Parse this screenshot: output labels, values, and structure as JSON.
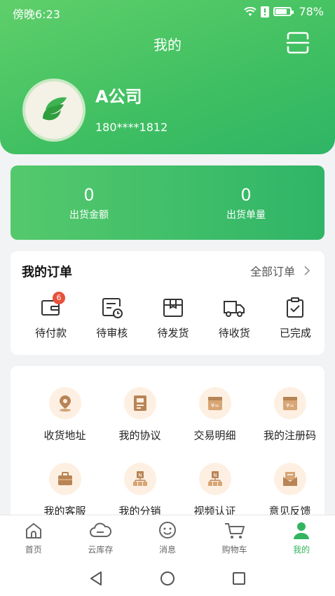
{
  "status_bar": {
    "time": "傍晚6:23",
    "battery": "78%"
  },
  "header": {
    "title": "我的"
  },
  "profile": {
    "company": "A公司",
    "phone": "180****1812"
  },
  "stats": [
    {
      "value": "0",
      "label": "出货金额"
    },
    {
      "value": "0",
      "label": "出货单量"
    }
  ],
  "orders": {
    "title": "我的订单",
    "all_label": "全部订单",
    "items": [
      {
        "label": "待付款",
        "badge": "6",
        "icon": "wallet-icon"
      },
      {
        "label": "待审核",
        "icon": "review-clock-icon"
      },
      {
        "label": "待发货",
        "icon": "package-icon"
      },
      {
        "label": "待收货",
        "icon": "truck-icon"
      },
      {
        "label": "已完成",
        "icon": "clipboard-check-icon"
      }
    ]
  },
  "services": [
    {
      "label": "收货地址",
      "icon": "location-pin-icon"
    },
    {
      "label": "我的协议",
      "icon": "agreement-icon"
    },
    {
      "label": "交易明细",
      "icon": "transaction-icon"
    },
    {
      "label": "我的注册码",
      "icon": "register-code-icon"
    },
    {
      "label": "我的客服",
      "icon": "briefcase-icon"
    },
    {
      "label": "我的分销",
      "icon": "distribution-icon"
    },
    {
      "label": "视频认证",
      "icon": "video-verify-icon"
    },
    {
      "label": "意见反馈",
      "icon": "feedback-mail-icon"
    }
  ],
  "tabs": [
    {
      "label": "首页",
      "icon": "home-icon"
    },
    {
      "label": "云库存",
      "icon": "cloud-icon"
    },
    {
      "label": "消息",
      "icon": "message-icon"
    },
    {
      "label": "购物车",
      "icon": "cart-icon"
    },
    {
      "label": "我的",
      "icon": "user-icon",
      "active": true
    }
  ],
  "colors": {
    "primary": "#33b55f",
    "badge": "#e8513b",
    "icon_brown": "#a8764b",
    "icon_bg": "#fdf0e2"
  }
}
